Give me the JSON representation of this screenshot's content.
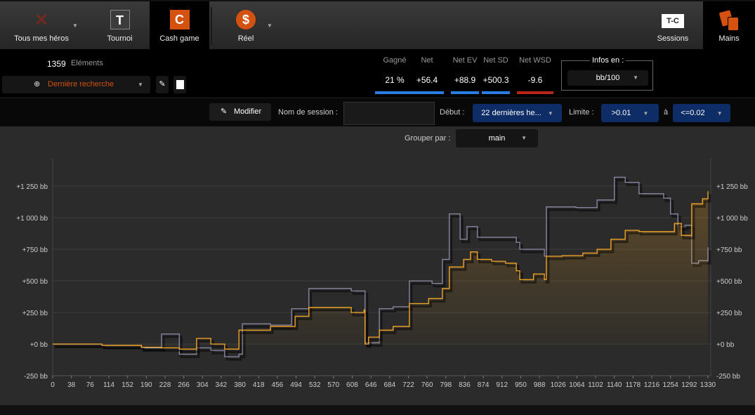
{
  "topbar": {
    "heroes": "Tous mes héros",
    "tournament": "Tournoi",
    "tournament_icon": "T",
    "cash": "Cash game",
    "cash_icon": "C",
    "real": "Réel",
    "sessions": "Sessions",
    "sessions_icon": "T-C",
    "hands": "Mains"
  },
  "summary": {
    "count": "1359",
    "count_label": "Eléments",
    "search": "Dernière recherche"
  },
  "stats": [
    {
      "label": "Gagné",
      "value": "21 %",
      "color": "#2a7de1"
    },
    {
      "label": "Net",
      "value": "+56.4",
      "color": "#2a7de1"
    },
    {
      "label": "Net EV",
      "value": "+88.9",
      "color": "#2a7de1"
    },
    {
      "label": "Net SD",
      "value": "+500.3",
      "color": "#2a7de1"
    },
    {
      "label": "Net WSD",
      "value": "-9.6",
      "color": "#b8261a"
    }
  ],
  "infos": {
    "legend": "Infos en :",
    "value": "bb/100"
  },
  "filter": {
    "modify": "Modifier",
    "session_name_label": "Nom de session :",
    "session_name_value": "",
    "start_label": "Début :",
    "start_value": "22 dernières he...",
    "limit_label": "Limite :",
    "limit_from": ">0.01",
    "to_label": "à",
    "limit_to": "<=0.02"
  },
  "group": {
    "label": "Grouper par :",
    "value": "main"
  },
  "chart_data": {
    "type": "line",
    "xlim": [
      0,
      1330
    ],
    "ylim": [
      -250,
      1350
    ],
    "yticks": [
      -250,
      0,
      250,
      500,
      750,
      1000,
      1250
    ],
    "ytick_labels": [
      "-250 bb",
      "+0 bb",
      "+250 bb",
      "+500 bb",
      "+750 bb",
      "+1 000 bb",
      "+1 250 bb"
    ],
    "xticks": [
      "0",
      "38",
      "76",
      "114",
      "152",
      "190",
      "228",
      "266",
      "304",
      "342",
      "380",
      "418",
      "456",
      "494",
      "532",
      "570",
      "608",
      "646",
      "684",
      "722",
      "760",
      "798",
      "836",
      "874",
      "912",
      "950",
      "988",
      "1026",
      "1064",
      "1102",
      "1140",
      "1178",
      "1216",
      "1254",
      "1292",
      "1330"
    ],
    "series": [
      {
        "name": "EV",
        "color": "#8c8aa6",
        "points": [
          [
            0,
            0
          ],
          [
            100,
            -10
          ],
          [
            180,
            -30
          ],
          [
            221,
            80
          ],
          [
            257,
            -80
          ],
          [
            292,
            -30
          ],
          [
            321,
            -50
          ],
          [
            349,
            -100
          ],
          [
            378,
            -80
          ],
          [
            385,
            160
          ],
          [
            442,
            150
          ],
          [
            485,
            280
          ],
          [
            520,
            440
          ],
          [
            606,
            420
          ],
          [
            632,
            420
          ],
          [
            634,
            10
          ],
          [
            663,
            280
          ],
          [
            691,
            295
          ],
          [
            724,
            500
          ],
          [
            770,
            480
          ],
          [
            791,
            670
          ],
          [
            805,
            1030
          ],
          [
            827,
            830
          ],
          [
            841,
            930
          ],
          [
            862,
            845
          ],
          [
            941,
            805
          ],
          [
            948,
            750
          ],
          [
            998,
            695
          ],
          [
            1002,
            1085
          ],
          [
            1062,
            1080
          ],
          [
            1105,
            1140
          ],
          [
            1140,
            1320
          ],
          [
            1162,
            1280
          ],
          [
            1190,
            1190
          ],
          [
            1240,
            1155
          ],
          [
            1254,
            1030
          ],
          [
            1269,
            930
          ],
          [
            1283,
            940
          ],
          [
            1297,
            640
          ],
          [
            1311,
            660
          ],
          [
            1330,
            765
          ]
        ]
      },
      {
        "name": "Net",
        "color": "#f5a623",
        "points": [
          [
            0,
            0
          ],
          [
            100,
            -10
          ],
          [
            180,
            -25
          ],
          [
            221,
            -30
          ],
          [
            257,
            -40
          ],
          [
            292,
            45
          ],
          [
            321,
            0
          ],
          [
            349,
            -40
          ],
          [
            378,
            110
          ],
          [
            442,
            140
          ],
          [
            492,
            220
          ],
          [
            520,
            290
          ],
          [
            606,
            250
          ],
          [
            632,
            270
          ],
          [
            634,
            0
          ],
          [
            641,
            55
          ],
          [
            663,
            110
          ],
          [
            691,
            140
          ],
          [
            724,
            320
          ],
          [
            763,
            360
          ],
          [
            791,
            440
          ],
          [
            805,
            610
          ],
          [
            834,
            670
          ],
          [
            848,
            730
          ],
          [
            862,
            670
          ],
          [
            891,
            655
          ],
          [
            919,
            640
          ],
          [
            941,
            580
          ],
          [
            948,
            510
          ],
          [
            976,
            555
          ],
          [
            998,
            510
          ],
          [
            1002,
            695
          ],
          [
            1034,
            700
          ],
          [
            1076,
            720
          ],
          [
            1105,
            750
          ],
          [
            1133,
            830
          ],
          [
            1162,
            900
          ],
          [
            1190,
            890
          ],
          [
            1233,
            890
          ],
          [
            1262,
            955
          ],
          [
            1276,
            860
          ],
          [
            1297,
            1110
          ],
          [
            1319,
            1150
          ],
          [
            1330,
            1210
          ]
        ]
      }
    ]
  }
}
